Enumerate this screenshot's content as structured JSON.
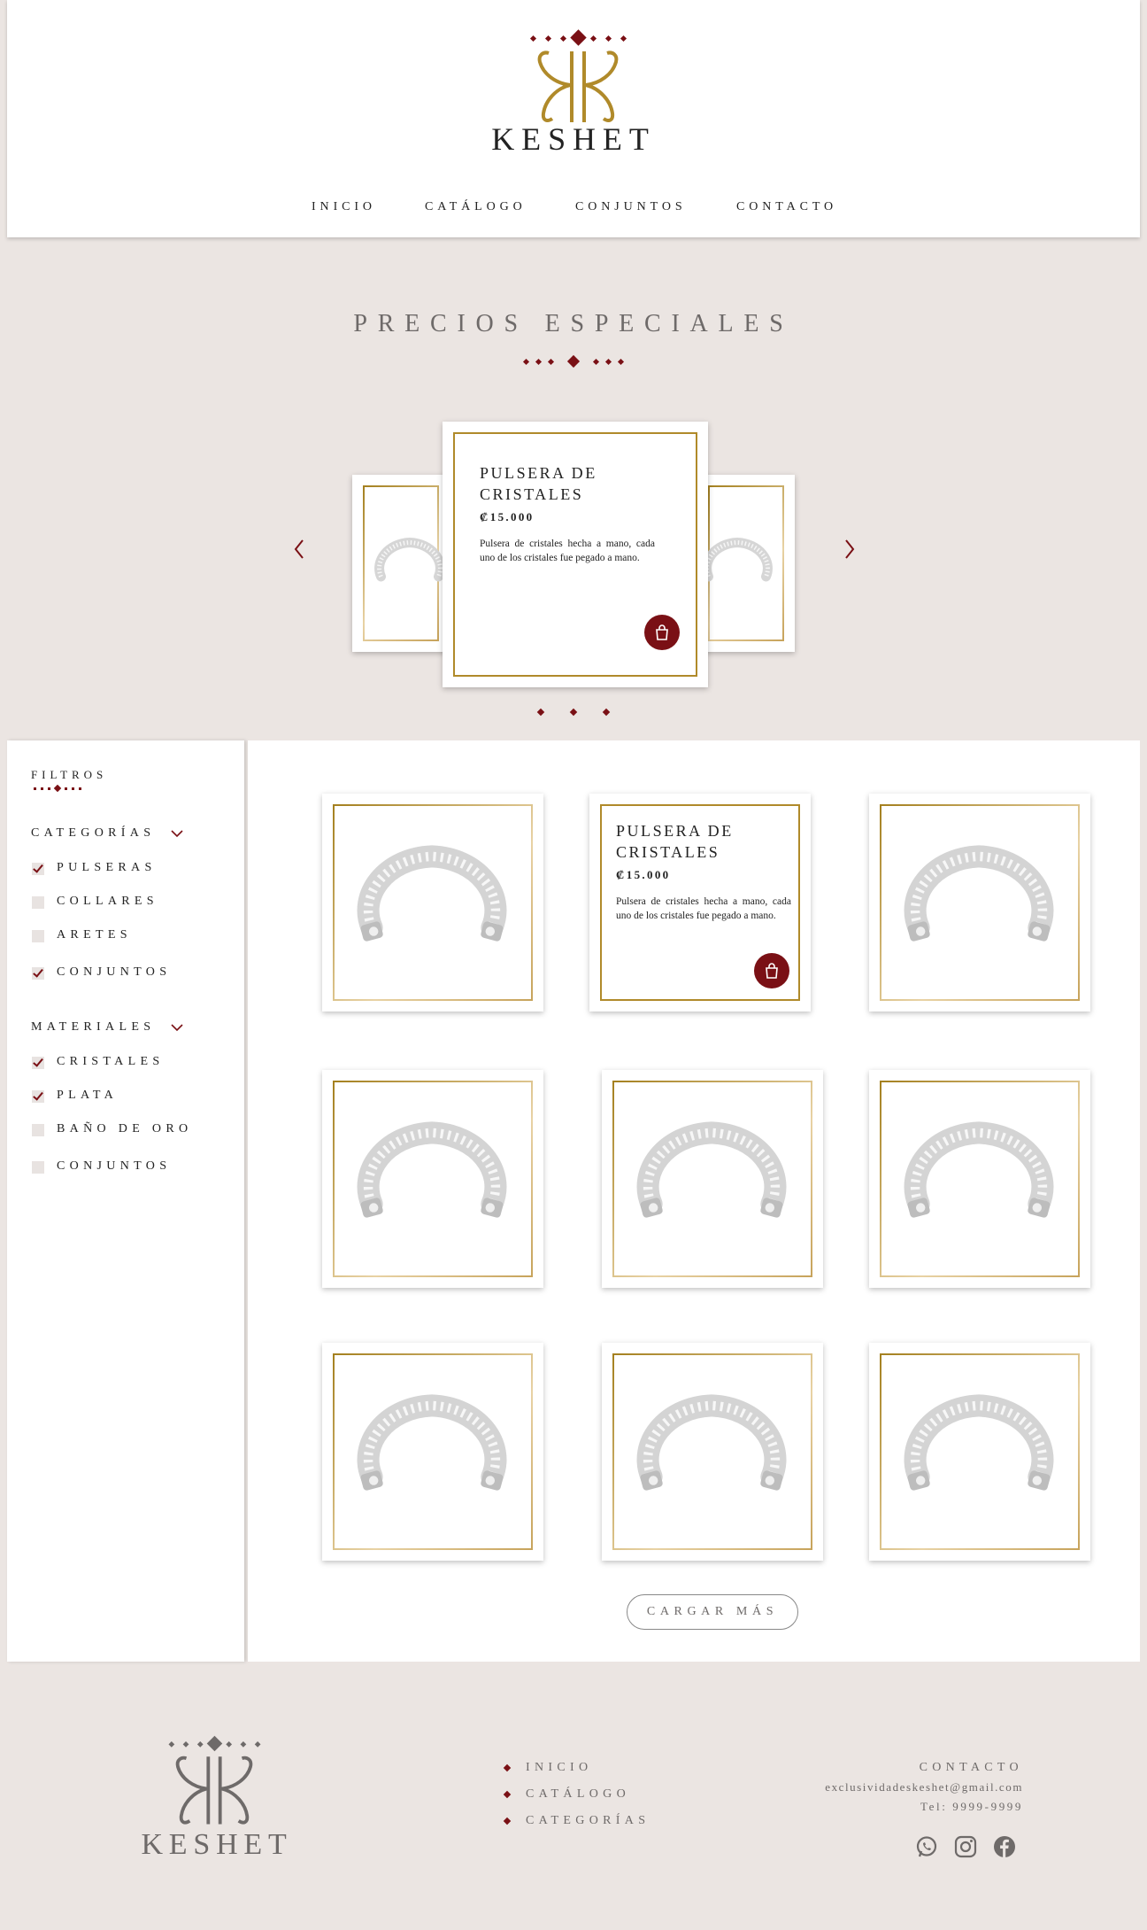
{
  "brand": {
    "name": "KESHET"
  },
  "nav": [
    "INICIO",
    "CATÁLOGO",
    "CONJUNTOS",
    "CONTACTO"
  ],
  "hero": {
    "title": "PRECIOS ESPECIALES"
  },
  "featured": {
    "title": "PULSERA DE CRISTALES",
    "price": "₡15.000",
    "description": "Pulsera de cristales hecha a mano, cada uno de los cristales fue pegado a mano."
  },
  "filters": {
    "heading": "FILTROS",
    "categories": {
      "label": "CATEGORÍAS",
      "items": [
        {
          "label": "PULSERAS",
          "checked": true
        },
        {
          "label": "COLLARES",
          "checked": false
        },
        {
          "label": "ARETES",
          "checked": false
        },
        {
          "label": "CONJUNTOS",
          "checked": true
        }
      ]
    },
    "materials": {
      "label": "MATERIALES",
      "items": [
        {
          "label": "CRISTALES",
          "checked": true
        },
        {
          "label": "PLATA",
          "checked": true
        },
        {
          "label": "BAÑO DE ORO",
          "checked": false
        },
        {
          "label": "CONJUNTOS",
          "checked": false
        }
      ]
    }
  },
  "grid_product": {
    "title": "PULSERA DE CRISTALES",
    "price": "₡15.000",
    "description": "Pulsera de cristales hecha a mano, cada uno de los cristales fue pegado a mano."
  },
  "load_more": "CARGAR MÁS",
  "footer": {
    "links": [
      "INICIO",
      "CATÁLOGO",
      "CATEGORÍAS"
    ],
    "contact_label": "CONTACTO",
    "email": "exclusividadeskeshet@gmail.com",
    "phone": "Tel: 9999-9999"
  },
  "colors": {
    "accent": "#7a1015",
    "gold": "#b08a2a",
    "muted": "#6e6a69",
    "background": "#ebe5e2"
  },
  "icons": [
    "chevron-left-icon",
    "chevron-right-icon",
    "shopping-bag-icon",
    "chevron-down-icon",
    "whatsapp-icon",
    "instagram-icon",
    "facebook-icon"
  ]
}
